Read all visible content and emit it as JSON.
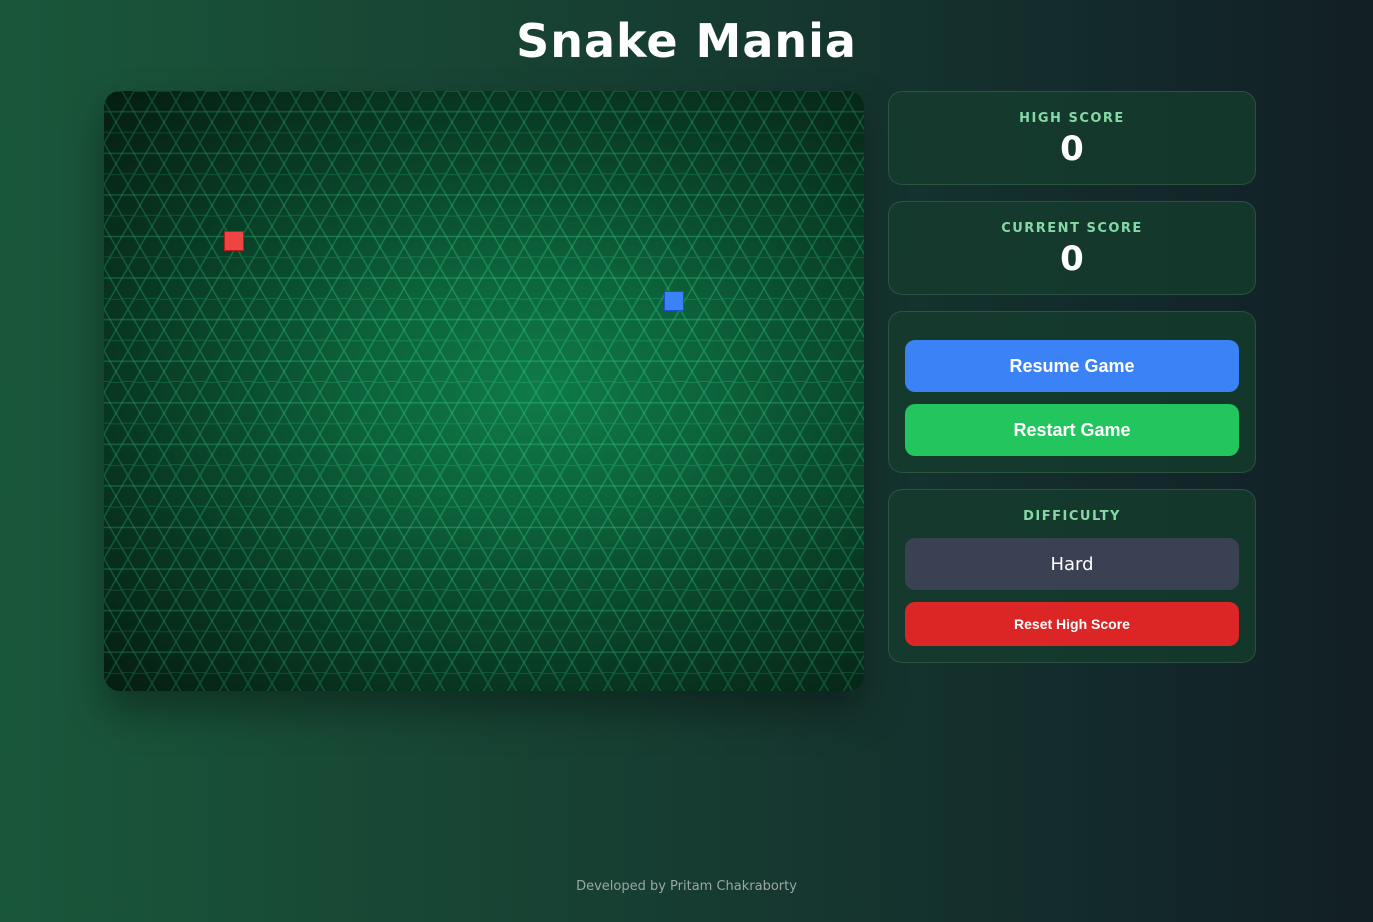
{
  "app": {
    "title": "Snake Mania"
  },
  "game": {
    "food_color": "#ef4444",
    "snake_color": "#3b82f6",
    "board_color": "#0c5e39"
  },
  "scores": {
    "high_score_label": "HIGH SCORE",
    "high_score_value": "0",
    "current_score_label": "CURRENT SCORE",
    "current_score_value": "0"
  },
  "controls": {
    "resume_label": "Resume Game",
    "restart_label": "Restart Game"
  },
  "difficulty": {
    "label": "DIFFICULTY",
    "selected": "Hard",
    "reset_high_score_label": "Reset High Score"
  },
  "footer": {
    "credit": "Developed by Pritam Chakraborty"
  },
  "colors": {
    "accent_blue": "#3b82f6",
    "accent_green": "#22c55e",
    "danger_red": "#dc2626",
    "label_green": "#86d9a6"
  }
}
